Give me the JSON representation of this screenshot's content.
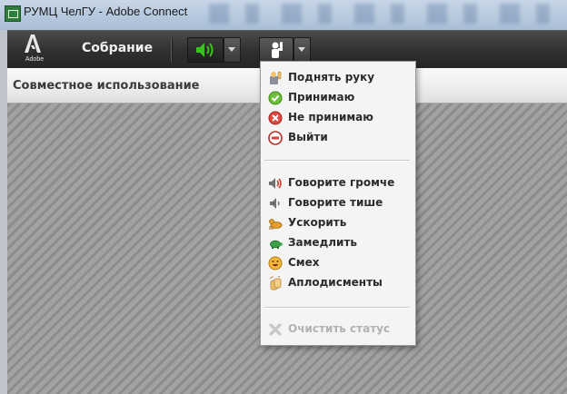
{
  "window": {
    "title": "РУМЦ ЧелГУ - Adobe Connect"
  },
  "toolbar": {
    "logo_text": "Adobe",
    "meeting_menu": "Собрание"
  },
  "pod": {
    "title": "Совместное использование"
  },
  "status_menu": {
    "group1": [
      {
        "label": "Поднять руку",
        "icon": "raise-hand-icon"
      },
      {
        "label": "Принимаю",
        "icon": "agree-icon"
      },
      {
        "label": "Не принимаю",
        "icon": "disagree-icon"
      },
      {
        "label": "Выйти",
        "icon": "step-away-icon"
      }
    ],
    "group2": [
      {
        "label": "Говорите громче",
        "icon": "speak-louder-icon"
      },
      {
        "label": "Говорите тише",
        "icon": "speak-softer-icon"
      },
      {
        "label": "Ускорить",
        "icon": "speed-up-icon"
      },
      {
        "label": "Замедлить",
        "icon": "slow-down-icon"
      },
      {
        "label": "Смех",
        "icon": "laughter-icon"
      },
      {
        "label": "Аплодисменты",
        "icon": "applause-icon"
      }
    ],
    "clear_status": {
      "label": "Очистить статус",
      "icon": "clear-status-icon",
      "enabled": false
    }
  },
  "colors": {
    "audio_active": "#3cc21e",
    "toolbar_bg": "#2f2f2f"
  }
}
